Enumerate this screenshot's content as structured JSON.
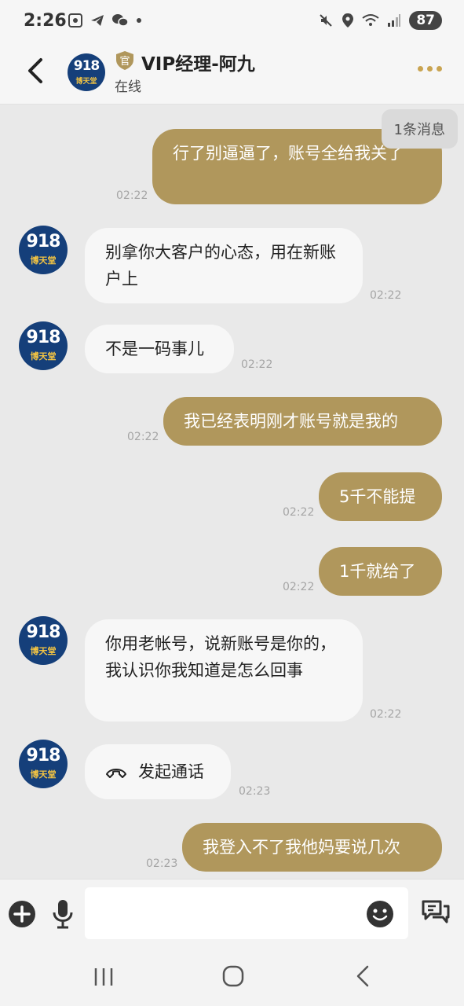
{
  "status_bar": {
    "time": "2:26",
    "battery": "87"
  },
  "header": {
    "title": "VIP经理-阿九",
    "status": "在线",
    "badge": "官"
  },
  "avatar": {
    "number": "918",
    "text": "博天堂"
  },
  "unread_chip": "1条消息",
  "messages": [
    {
      "dir": "out",
      "text": "行了别逼逼了，账号全给我关了",
      "time": "02:22"
    },
    {
      "dir": "in",
      "text": "别拿你大客户的心态，用在新账户上",
      "time": "02:22"
    },
    {
      "dir": "in",
      "text": "不是一码事儿",
      "time": "02:22"
    },
    {
      "dir": "out",
      "text": "我已经表明刚才账号就是我的",
      "time": "02:22"
    },
    {
      "dir": "out",
      "text": "5千不能提",
      "time": "02:22"
    },
    {
      "dir": "out",
      "text": "1千就给了",
      "time": "02:22"
    },
    {
      "dir": "in",
      "text": "你用老帐号，说新账号是你的，我认识你我知道是怎么回事",
      "time": "02:22"
    },
    {
      "dir": "in",
      "text": "发起通话",
      "time": "02:23",
      "icon": "phone-hangup-icon"
    },
    {
      "dir": "out",
      "text": "我登入不了我他妈要说几次",
      "time": "02:23"
    }
  ],
  "input": {
    "placeholder": ""
  }
}
